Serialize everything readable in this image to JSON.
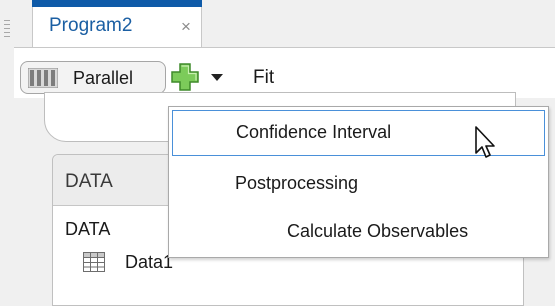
{
  "tab": {
    "label": "Program2",
    "close_icon": "×"
  },
  "toolbar": {
    "parallel_label": "Parallel",
    "fit_label": "Fit",
    "add_icon_color": "#6ab04c"
  },
  "menu": {
    "items": [
      {
        "label": "Confidence Interval",
        "highlighted": true
      },
      {
        "label": "Postprocessing"
      },
      {
        "label": "Calculate Observables"
      }
    ]
  },
  "panel": {
    "header_label": "DATA",
    "section_label": "DATA",
    "items": [
      {
        "label": "Data1",
        "icon": "table-icon"
      }
    ]
  },
  "colors": {
    "tab_accent": "#0e5aa8",
    "tab_text": "#1b5fa3",
    "highlight_border": "#4a90d9"
  }
}
